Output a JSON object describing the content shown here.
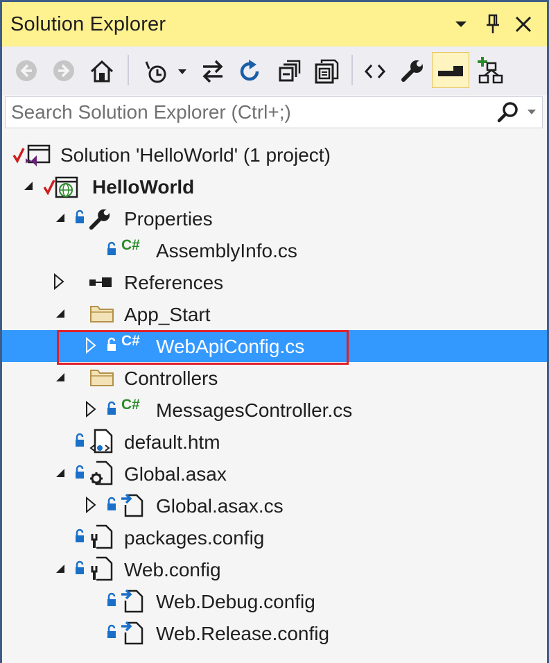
{
  "window": {
    "title": "Solution Explorer"
  },
  "toolbar": {
    "items": [
      "back-icon",
      "forward-icon",
      "home-icon",
      "pending-changes-filter-icon",
      "sync-with-active-document-icon",
      "refresh-icon",
      "collapse-all-icon",
      "show-all-files-icon",
      "view-code-icon",
      "properties-icon",
      "preview-selected-items-icon",
      "view-class-diagram-icon"
    ]
  },
  "search": {
    "placeholder": "Search Solution Explorer (Ctrl+;)"
  },
  "colors": {
    "title_bar": "#fdf190",
    "selection": "#3399ff",
    "highlight_box": "#e0202a",
    "frame": "#3f5c88"
  },
  "tree": {
    "solution": "Solution 'HelloWorld' (1 project)",
    "project": "HelloWorld",
    "properties": "Properties",
    "assembly_info": "AssemblyInfo.cs",
    "references": "References",
    "app_start": "App_Start",
    "webapi_config": "WebApiConfig.cs",
    "controllers": "Controllers",
    "messages_controller": "MessagesController.cs",
    "default_htm": "default.htm",
    "global_asax": "Global.asax",
    "global_asax_cs": "Global.asax.cs",
    "packages_config": "packages.config",
    "web_config": "Web.config",
    "web_debug_config": "Web.Debug.config",
    "web_release_config": "Web.Release.config"
  }
}
